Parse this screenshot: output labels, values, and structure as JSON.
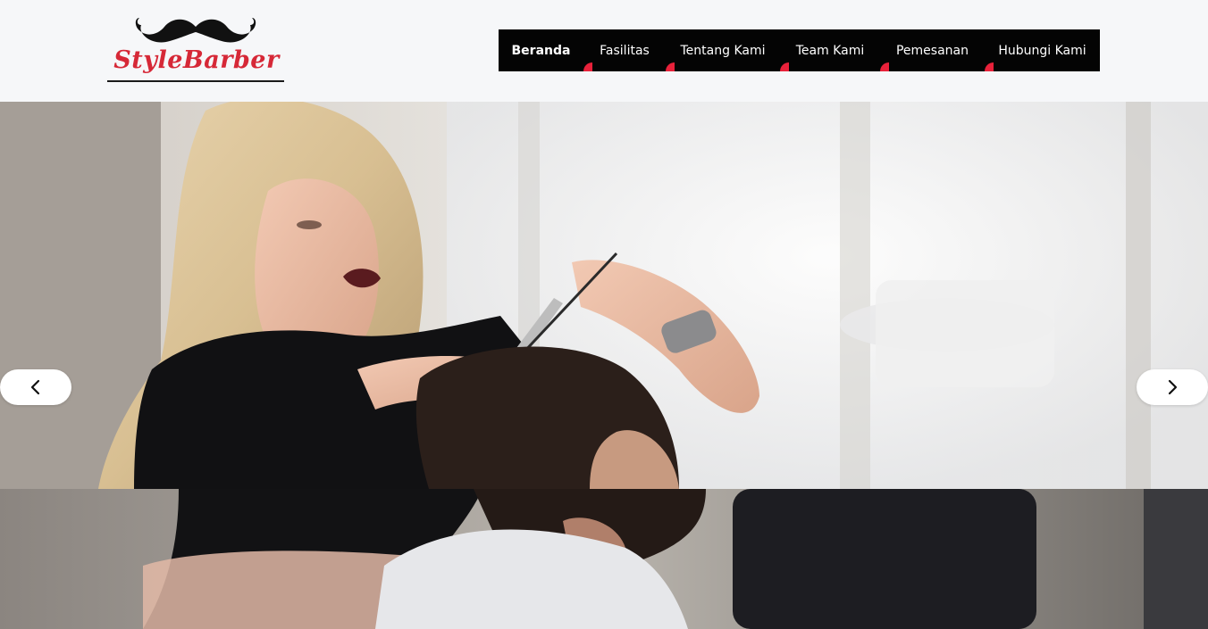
{
  "brand": {
    "name": "StyleBarber",
    "logo_icon": "mustache-icon",
    "accent_color": "#d62837"
  },
  "nav": {
    "items": [
      {
        "label": "Beranda",
        "active": true
      },
      {
        "label": "Fasilitas",
        "active": false
      },
      {
        "label": "Tentang Kami",
        "active": false
      },
      {
        "label": "Team Kami",
        "active": false
      },
      {
        "label": "Pemesanan",
        "active": false
      },
      {
        "label": "Hubungi Kami",
        "active": false
      }
    ],
    "background": "#040404",
    "marker_color": "#e8213a"
  },
  "slider": {
    "prev_icon": "chevron-left-icon",
    "next_icon": "chevron-right-icon",
    "image": "barber-cutting-hair-photo"
  }
}
